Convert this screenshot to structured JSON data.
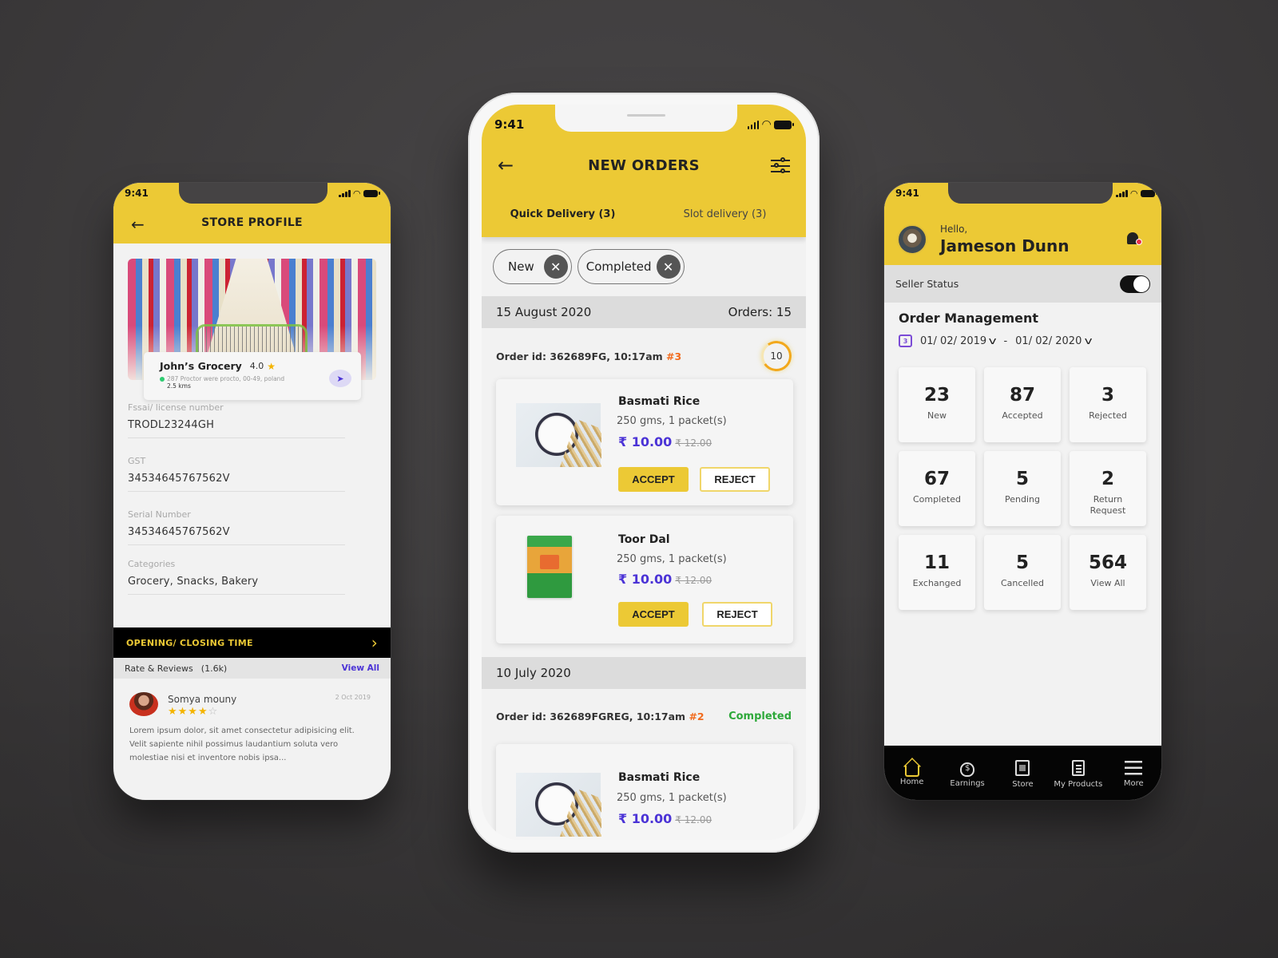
{
  "status_time": "9:41",
  "store_profile": {
    "title": "STORE PROFILE",
    "store_name": "John’s Grocery",
    "rating": "4.0",
    "address": "287 Proctor were procto, 00-49, poland",
    "distance": "2.5 kms",
    "fields": [
      {
        "label": "Fssai/ license number",
        "value": "TRODL23244GH"
      },
      {
        "label": "GST",
        "value": "34534645767562V"
      },
      {
        "label": "Serial Number",
        "value": "34534645767562V"
      },
      {
        "label": "Categories",
        "value": "Grocery, Snacks, Bakery"
      }
    ],
    "hours_label": "OPENING/ CLOSING TIME",
    "reviews_label": "Rate & Reviews",
    "reviews_count": "(1.6k)",
    "view_all": "View All",
    "review": {
      "author": "Somya mouny",
      "stars": 4,
      "stars_filled": "★★★★",
      "stars_empty": "☆",
      "date": "2 Oct 2019",
      "text": "Lorem ipsum dolor, sit amet consectetur adipisicing elit. Velit sapiente nihil possimus laudantium soluta vero molestiae nisi et inventore nobis ipsa..."
    }
  },
  "new_orders": {
    "title": "NEW ORDERS",
    "tabs": [
      {
        "label": "Quick Delivery (3)",
        "active": true
      },
      {
        "label": "Slot delivery (3)",
        "active": false
      }
    ],
    "chips": [
      {
        "label": "New"
      },
      {
        "label": "Completed"
      }
    ],
    "groups": [
      {
        "date": "15 August 2020",
        "orders_count": "Orders: 15",
        "order_id": "Order id: 362689FG, 10:17am",
        "order_num": "#3",
        "timer": "10",
        "items": [
          {
            "name": "Basmati Rice",
            "qty": "250 gms, 1 packet(s)",
            "price": "₹ 10.00",
            "old_price": "₹ 12.00",
            "accept": "ACCEPT",
            "reject": "REJECT"
          },
          {
            "name": "Toor Dal",
            "qty": "250 gms, 1 packet(s)",
            "price": "₹ 10.00",
            "old_price": "₹ 12.00",
            "accept": "ACCEPT",
            "reject": "REJECT"
          }
        ]
      },
      {
        "date": "10 July 2020",
        "order_id": "Order id: 362689FGREG, 10:17am",
        "order_num": "#2",
        "status": "Completed",
        "items": [
          {
            "name": "Basmati Rice",
            "qty": "250 gms, 1 packet(s)",
            "price": "₹ 10.00",
            "old_price": "₹ 12.00"
          }
        ]
      }
    ]
  },
  "dashboard": {
    "greeting": "Hello,",
    "user_name": "Jameson Dunn",
    "seller_status_label": "Seller Status",
    "seller_status_on": true,
    "section_title": "Order Management",
    "calendar_day": "3",
    "date_from": "01/ 02/ 2019",
    "date_sep": "-",
    "date_to": "01/ 02/ 2020",
    "stats": [
      {
        "value": "23",
        "label": "New"
      },
      {
        "value": "87",
        "label": "Accepted"
      },
      {
        "value": "3",
        "label": "Rejected"
      },
      {
        "value": "67",
        "label": "Completed"
      },
      {
        "value": "5",
        "label": "Pending"
      },
      {
        "value": "2",
        "label": "Return Request"
      },
      {
        "value": "11",
        "label": "Exchanged"
      },
      {
        "value": "5",
        "label": "Cancelled"
      },
      {
        "value": "564",
        "label": "View All"
      }
    ],
    "nav": [
      {
        "label": "Home",
        "icon": "home-icon",
        "active": true
      },
      {
        "label": "Earnings",
        "icon": "earnings-icon"
      },
      {
        "label": "Store",
        "icon": "store-icon"
      },
      {
        "label": "My Products",
        "icon": "products-icon"
      },
      {
        "label": "More",
        "icon": "menu-icon"
      }
    ]
  },
  "colors": {
    "brand_yellow": "#ecc935",
    "price_purple": "#4b33d6",
    "order_number_orange": "#f26b1d",
    "completed_green": "#2ea83a",
    "background": "#3e3c3d"
  }
}
